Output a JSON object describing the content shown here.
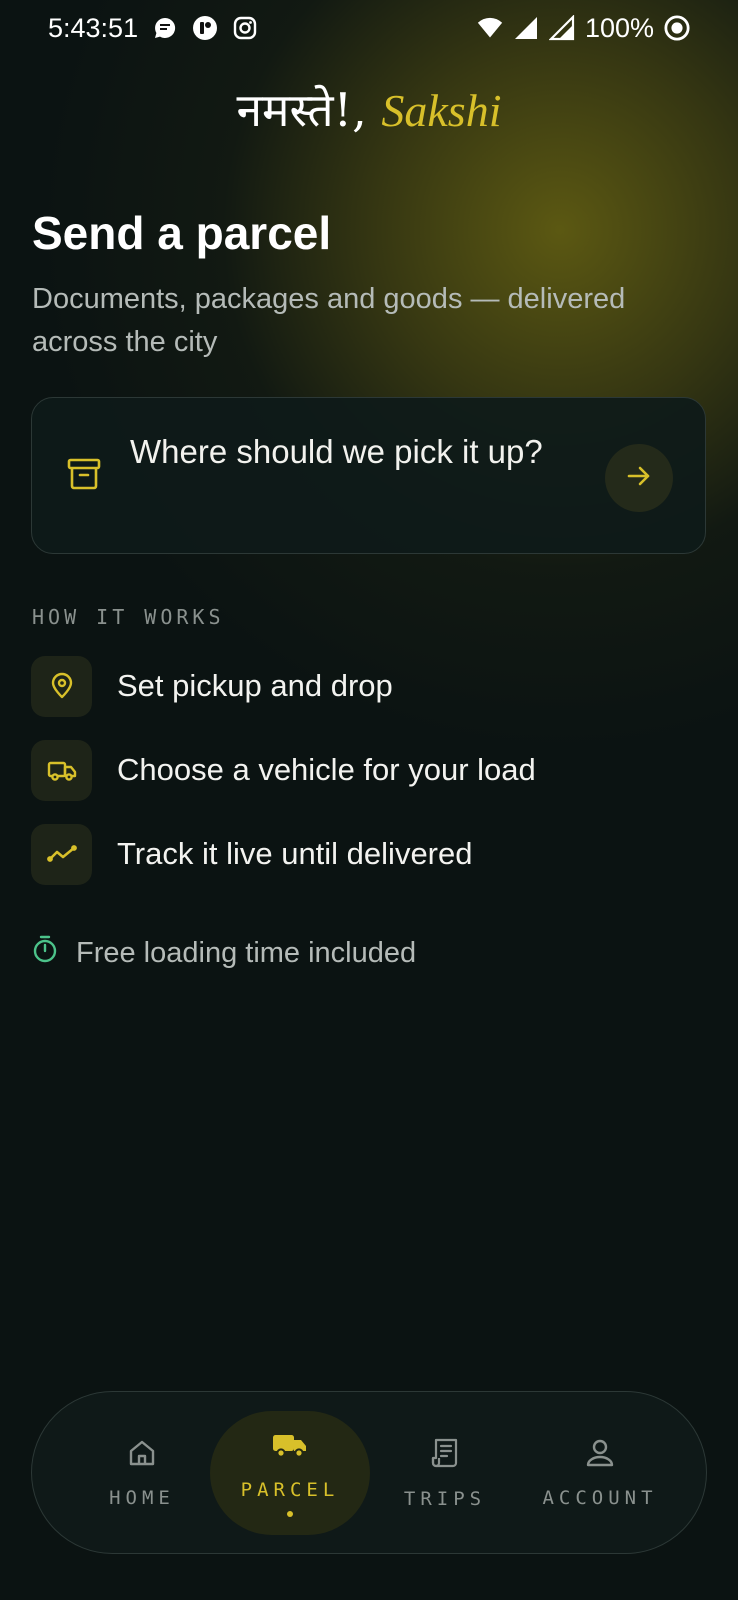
{
  "status_bar": {
    "time": "5:43:51",
    "battery": "100%",
    "icons": [
      "chat-bubble-icon",
      "app-badge-icon",
      "instagram-icon",
      "wifi-icon",
      "signal-icon",
      "signal-icon",
      "battery-saver-icon"
    ]
  },
  "header": {
    "greeting": "नमस्ते!,",
    "name": "Sakshi"
  },
  "main": {
    "title": "Send a parcel",
    "subtitle": "Documents, packages and goods — delivered across the city",
    "pickup_prompt": "Where should we pick it up?",
    "pickup_icon": "archive-box-icon",
    "pickup_action_icon": "arrow-right-icon"
  },
  "how_it_works": {
    "label": "HOW IT WORKS",
    "steps": [
      {
        "icon": "map-pin-icon",
        "label": "Set pickup and drop"
      },
      {
        "icon": "truck-icon",
        "label": "Choose a vehicle for your load"
      },
      {
        "icon": "trend-line-icon",
        "label": "Track it live until delivered"
      }
    ]
  },
  "note": {
    "icon": "stopwatch-icon",
    "text": "Free loading time included"
  },
  "bottom_nav": {
    "items": [
      {
        "icon": "home-icon",
        "label": "HOME",
        "active": false
      },
      {
        "icon": "truck-icon",
        "label": "PARCEL",
        "active": true
      },
      {
        "icon": "receipt-icon",
        "label": "TRIPS",
        "active": false
      },
      {
        "icon": "user-icon",
        "label": "ACCOUNT",
        "active": false
      }
    ]
  },
  "colors": {
    "background": "#0b1312",
    "accent": "#d8c02a",
    "muted_text": "#b5bbb8",
    "success": "#4cc38a"
  }
}
